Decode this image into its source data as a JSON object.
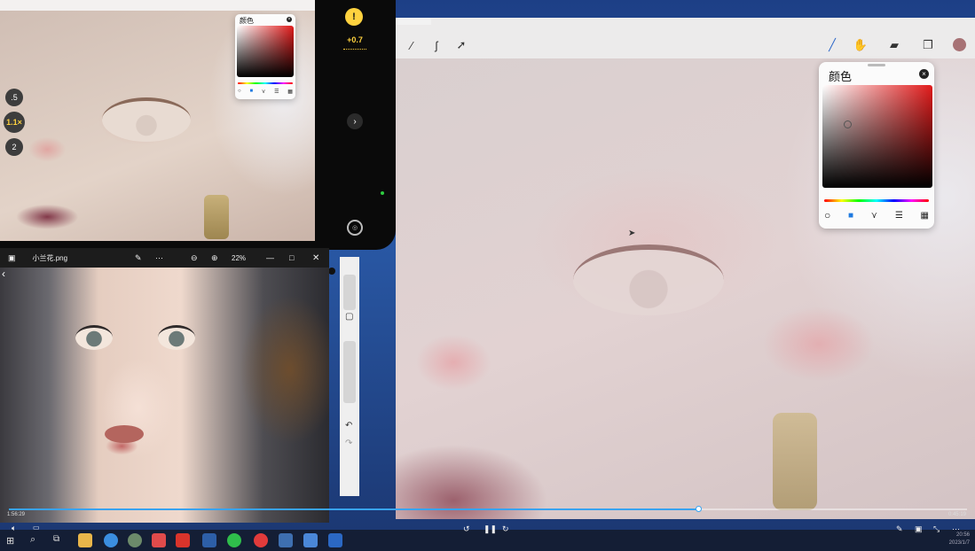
{
  "phone": {
    "warning_icon": "warning-triangle-icon",
    "exposure_value": "+0.7",
    "zoom_options": [
      ".5",
      "1.1×",
      "2"
    ],
    "active_zoom_index": 1,
    "color_panel_title": "颜色"
  },
  "canvas": {
    "color_panel": {
      "title": "颜色",
      "selected_mode_index": 1
    },
    "current_color": "#a77275"
  },
  "viewer": {
    "filename": "小兰花.png",
    "zoom_label": "22%"
  },
  "video": {
    "elapsed": "1:56:29",
    "duration": "0:45:19",
    "progress": 0.72
  },
  "tray": {
    "time": "20:56",
    "date": "2023/1/7"
  },
  "colors": {
    "accent": "#38a3f0",
    "taskbar": "#141c30"
  }
}
